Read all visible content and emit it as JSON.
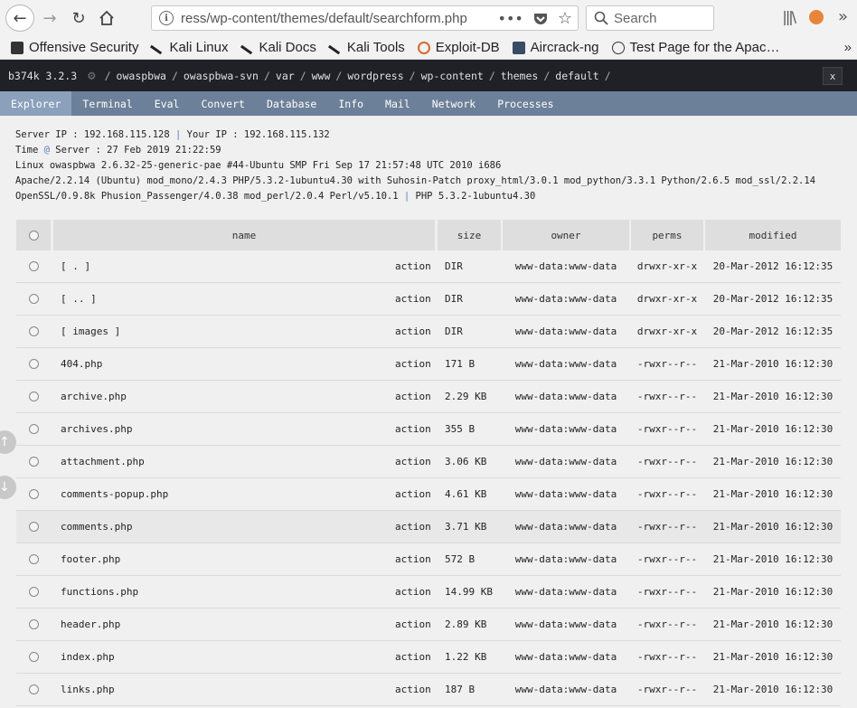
{
  "browser": {
    "url": "ress/wp-content/themes/default/searchform.php",
    "search_placeholder": "Search",
    "bookmarks": [
      {
        "label": "Offensive Security",
        "icon": "offsec-icon"
      },
      {
        "label": "Kali Linux",
        "icon": "kali-dragon-icon"
      },
      {
        "label": "Kali Docs",
        "icon": "kali-dragon-icon"
      },
      {
        "label": "Kali Tools",
        "icon": "kali-dragon-icon"
      },
      {
        "label": "Exploit-DB",
        "icon": "exploit-db-icon"
      },
      {
        "label": "Aircrack-ng",
        "icon": "aircrack-icon"
      },
      {
        "label": "Test Page for the Apac…",
        "icon": "globe-icon"
      }
    ]
  },
  "shell": {
    "title": "b374k 3.2.3",
    "path": [
      "owaspbwa",
      "owaspbwa-svn",
      "var",
      "www",
      "wordpress",
      "wp-content",
      "themes",
      "default"
    ],
    "close_label": "x"
  },
  "menu": [
    "Explorer",
    "Terminal",
    "Eval",
    "Convert",
    "Database",
    "Info",
    "Mail",
    "Network",
    "Processes"
  ],
  "info": {
    "server_ip_label": "Server IP : 192.168.115.128",
    "your_ip_label": "Your IP : 192.168.115.132",
    "time_prefix": "Time",
    "time_at": "@",
    "time_suffix": "Server : 27 Feb 2019 21:22:59",
    "uname": "Linux owaspbwa 2.6.32-25-generic-pae #44-Ubuntu SMP Fri Sep 17 21:57:48 UTC 2010 i686",
    "software": "Apache/2.2.14 (Ubuntu) mod_mono/2.4.3 PHP/5.3.2-1ubuntu4.30 with Suhosin-Patch proxy_html/3.0.1 mod_python/3.3.1 Python/2.6.5 mod_ssl/2.2.14",
    "software2": "OpenSSL/0.9.8k Phusion_Passenger/4.0.38 mod_perl/2.0.4 Perl/v5.10.1",
    "php": "PHP 5.3.2-1ubuntu4.30"
  },
  "table": {
    "headers": {
      "name": "name",
      "size": "size",
      "owner": "owner",
      "perms": "perms",
      "modified": "modified"
    },
    "rows": [
      {
        "name": "[ . ]",
        "action": "action",
        "size": "DIR",
        "owner": "www-data:www-data",
        "perms": "drwxr-xr-x",
        "modified": "20-Mar-2012 16:12:35"
      },
      {
        "name": "[ .. ]",
        "action": "action",
        "size": "DIR",
        "owner": "www-data:www-data",
        "perms": "drwxr-xr-x",
        "modified": "20-Mar-2012 16:12:35"
      },
      {
        "name": "[ images ]",
        "action": "action",
        "size": "DIR",
        "owner": "www-data:www-data",
        "perms": "drwxr-xr-x",
        "modified": "20-Mar-2012 16:12:35"
      },
      {
        "name": "404.php",
        "action": "action",
        "size": "171 B",
        "owner": "www-data:www-data",
        "perms": "-rwxr--r--",
        "modified": "21-Mar-2010 16:12:30"
      },
      {
        "name": "archive.php",
        "action": "action",
        "size": "2.29 KB",
        "owner": "www-data:www-data",
        "perms": "-rwxr--r--",
        "modified": "21-Mar-2010 16:12:30"
      },
      {
        "name": "archives.php",
        "action": "action",
        "size": "355 B",
        "owner": "www-data:www-data",
        "perms": "-rwxr--r--",
        "modified": "21-Mar-2010 16:12:30"
      },
      {
        "name": "attachment.php",
        "action": "action",
        "size": "3.06 KB",
        "owner": "www-data:www-data",
        "perms": "-rwxr--r--",
        "modified": "21-Mar-2010 16:12:30"
      },
      {
        "name": "comments-popup.php",
        "action": "action",
        "size": "4.61 KB",
        "owner": "www-data:www-data",
        "perms": "-rwxr--r--",
        "modified": "21-Mar-2010 16:12:30"
      },
      {
        "name": "comments.php",
        "action": "action",
        "size": "3.71 KB",
        "owner": "www-data:www-data",
        "perms": "-rwxr--r--",
        "modified": "21-Mar-2010 16:12:30"
      },
      {
        "name": "footer.php",
        "action": "action",
        "size": "572 B",
        "owner": "www-data:www-data",
        "perms": "-rwxr--r--",
        "modified": "21-Mar-2010 16:12:30"
      },
      {
        "name": "functions.php",
        "action": "action",
        "size": "14.99 KB",
        "owner": "www-data:www-data",
        "perms": "-rwxr--r--",
        "modified": "21-Mar-2010 16:12:30"
      },
      {
        "name": "header.php",
        "action": "action",
        "size": "2.89 KB",
        "owner": "www-data:www-data",
        "perms": "-rwxr--r--",
        "modified": "21-Mar-2010 16:12:30"
      },
      {
        "name": "index.php",
        "action": "action",
        "size": "1.22 KB",
        "owner": "www-data:www-data",
        "perms": "-rwxr--r--",
        "modified": "21-Mar-2010 16:12:30"
      },
      {
        "name": "links.php",
        "action": "action",
        "size": "187 B",
        "owner": "www-data:www-data",
        "perms": "-rwxr--r--",
        "modified": "21-Mar-2010 16:12:30"
      }
    ]
  }
}
